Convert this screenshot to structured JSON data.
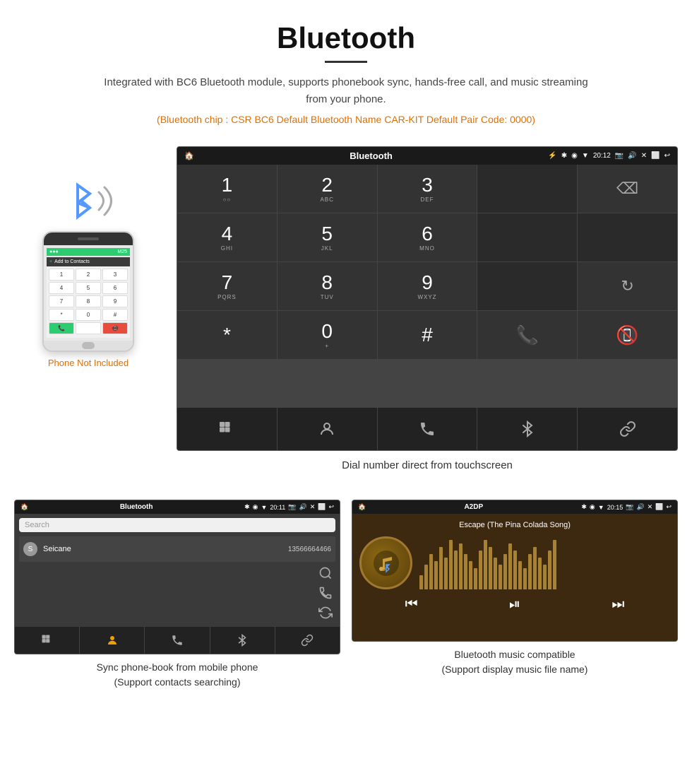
{
  "header": {
    "title": "Bluetooth",
    "description": "Integrated with BC6 Bluetooth module, supports phonebook sync, hands-free call, and music streaming from your phone.",
    "specs": "(Bluetooth chip : CSR BC6    Default Bluetooth Name CAR-KIT    Default Pair Code: 0000)"
  },
  "phone_label": "Phone Not Included",
  "main_screen": {
    "status": {
      "app_name": "Bluetooth",
      "time": "20:12",
      "usb_icon": "⚡",
      "bt_icon": "✱",
      "location_icon": "◉",
      "signal_icon": "▼"
    },
    "dialpad": [
      {
        "number": "1",
        "letters": "○○"
      },
      {
        "number": "2",
        "letters": "ABC"
      },
      {
        "number": "3",
        "letters": "DEF"
      },
      {
        "number": "",
        "letters": ""
      },
      {
        "number": "⌫",
        "letters": ""
      },
      {
        "number": "4",
        "letters": "GHI"
      },
      {
        "number": "5",
        "letters": "JKL"
      },
      {
        "number": "6",
        "letters": "MNO"
      },
      {
        "number": "",
        "letters": ""
      },
      {
        "number": "",
        "letters": ""
      },
      {
        "number": "7",
        "letters": "PQRS"
      },
      {
        "number": "8",
        "letters": "TUV"
      },
      {
        "number": "9",
        "letters": "WXYZ"
      },
      {
        "number": "",
        "letters": ""
      },
      {
        "number": "↻",
        "letters": ""
      },
      {
        "number": "*",
        "letters": ""
      },
      {
        "number": "0",
        "letters": "+"
      },
      {
        "number": "#",
        "letters": ""
      },
      {
        "number": "📞",
        "letters": ""
      },
      {
        "number": "📵",
        "letters": ""
      }
    ],
    "action_icons": [
      "⊞",
      "👤",
      "📞",
      "✱",
      "🔗"
    ]
  },
  "screen_caption": "Dial number direct from touchscreen",
  "contacts_screen": {
    "status": {
      "app_name": "Bluetooth",
      "time": "20:11"
    },
    "search_placeholder": "Search",
    "contacts": [
      {
        "letter": "S",
        "name": "Seicane",
        "phone": "13566664466"
      }
    ],
    "action_icons": [
      "⊞",
      "👤",
      "📞",
      "✱",
      "🔗"
    ]
  },
  "contacts_caption": "Sync phone-book from mobile phone\n(Support contacts searching)",
  "music_screen": {
    "status": {
      "app_name": "A2DP",
      "time": "20:15"
    },
    "song_title": "Escape (The Pina Colada Song)",
    "controls": [
      "⏮",
      "⏯",
      "⏭"
    ]
  },
  "music_caption": "Bluetooth music compatible\n(Support display music file name)",
  "music_bars": [
    20,
    35,
    50,
    40,
    60,
    45,
    70,
    55,
    65,
    50,
    40,
    30,
    55,
    70,
    60,
    45,
    35,
    50,
    65,
    55,
    40,
    30,
    50,
    60,
    45,
    35,
    55,
    70
  ]
}
